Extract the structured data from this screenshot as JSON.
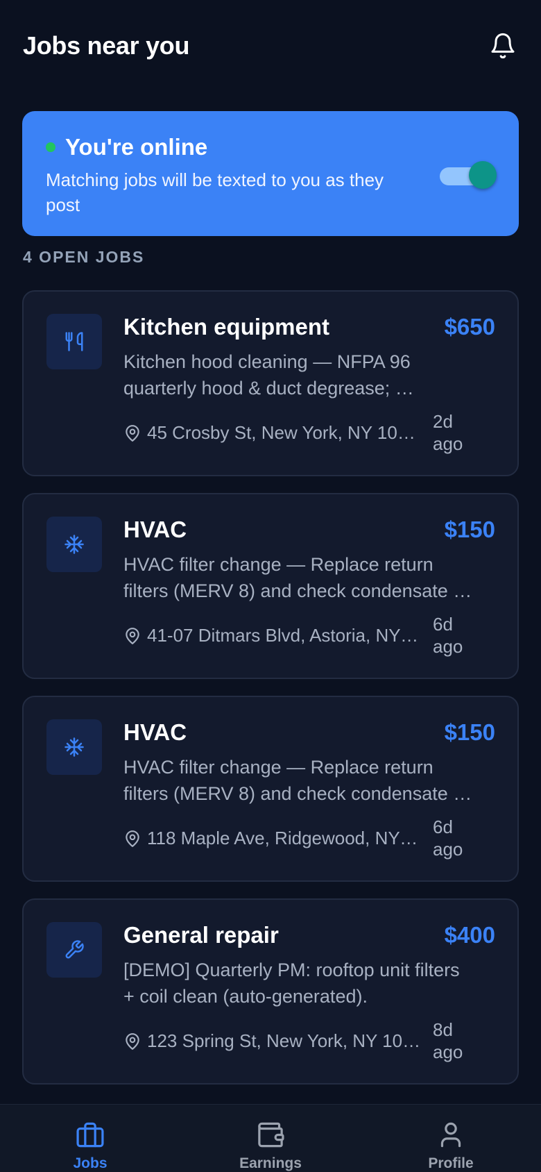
{
  "header": {
    "title": "Jobs near you",
    "bell_icon": "bell-icon"
  },
  "status": {
    "title": "You're online",
    "description_line1": "Matching jobs will be texted to you as they",
    "description_line2": "post",
    "toggle_on": true,
    "dot_color": "#22c55e",
    "card_color": "#3b82f6"
  },
  "jobs_count_label": "4 OPEN JOBS",
  "jobs": [
    {
      "icon": "utensils-icon",
      "category": "Kitchen equipment",
      "price": "$650",
      "desc_line1": "Kitchen hood cleaning — NFPA 96",
      "desc_line2": "quarterly hood & duct degrease; …",
      "address": "45 Crosby St, New York, NY 10…",
      "age_line1": "2d",
      "age_line2": "ago"
    },
    {
      "icon": "snowflake-icon",
      "category": "HVAC",
      "price": "$150",
      "desc_line1": "HVAC filter change — Replace return",
      "desc_line2": "filters (MERV 8) and check condensate …",
      "address": "41-07 Ditmars Blvd, Astoria, NY …",
      "age_line1": "6d",
      "age_line2": "ago"
    },
    {
      "icon": "snowflake-icon",
      "category": "HVAC",
      "price": "$150",
      "desc_line1": "HVAC filter change — Replace return",
      "desc_line2": "filters (MERV 8) and check condensate …",
      "address": "118 Maple Ave, Ridgewood, NY …",
      "age_line1": "6d",
      "age_line2": "ago"
    },
    {
      "icon": "wrench-icon",
      "category": "General repair",
      "price": "$400",
      "desc_line1": "[DEMO] Quarterly PM: rooftop unit filters",
      "desc_line2": "+ coil clean (auto-generated).",
      "address": "123 Spring St, New York, NY 10…",
      "age_line1": "8d",
      "age_line2": "ago"
    }
  ],
  "tabs": [
    {
      "label": "Jobs",
      "icon": "briefcase-icon",
      "active": true
    },
    {
      "label": "Earnings",
      "icon": "wallet-icon",
      "active": false
    },
    {
      "label": "Profile",
      "icon": "user-icon",
      "active": false
    }
  ],
  "colors": {
    "accent": "#3b82f6",
    "background": "#0b1120",
    "card": "#131a2d"
  }
}
